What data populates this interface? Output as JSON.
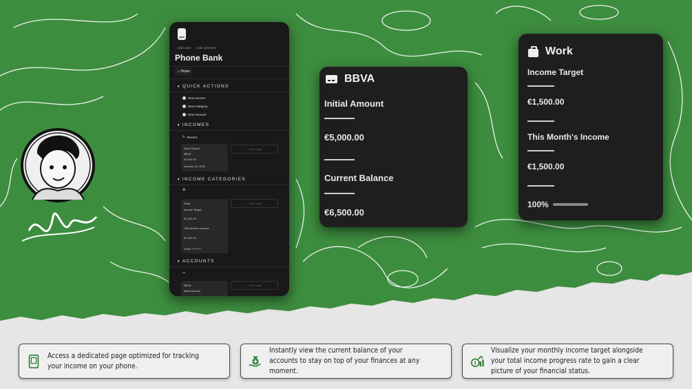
{
  "phone": {
    "meta_cover": "Add cover",
    "meta_comment": "Add comment",
    "title": "Phone Bank",
    "home": "Home",
    "sections": {
      "quick_actions": "QUICK ACTIONS",
      "incomes": "INCOMES",
      "income_categories": "INCOME CATEGORIES",
      "accounts": "ACCOUNTS"
    },
    "quick_actions": [
      "New Income",
      "New Category",
      "New Account"
    ],
    "recent": "Recent",
    "new_page": "+ New page",
    "income_card": {
      "title": "Work Payroll",
      "account": "BBVA",
      "amount": "€1,500.00",
      "date": "January 18, 2025"
    },
    "category_card": {
      "title": "Work",
      "target_label": "Income Target",
      "target": "€1,500.00",
      "month_label": "This Month's Income",
      "month": "€1,500.00",
      "percent": "100%"
    },
    "account_card": {
      "title": "BBVA",
      "label": "Initial Amount"
    }
  },
  "bbva_card": {
    "title": "BBVA",
    "initial_label": "Initial Amount",
    "initial_value": "€5,000.00",
    "balance_label": "Current Balance",
    "balance_value": "€6,500.00"
  },
  "work_card": {
    "title": "Work",
    "target_label": "Income Target",
    "target_value": "€1,500.00",
    "month_label": "This Month's Income",
    "month_value": "€1,500.00",
    "percent": "100%",
    "progress_fraction": 1.0
  },
  "features": [
    {
      "icon": "phone-icon",
      "text": "Access a dedicated page optimized for tracking your income on your phone."
    },
    {
      "icon": "money-hand-icon",
      "text": "Instantly view the current balance of your accounts to stay on top of your finances at any moment."
    },
    {
      "icon": "money-growth-icon",
      "text": "Visualize your monthly income target alongside your total income progress rate to gain a clear picture of your financial status."
    }
  ],
  "colors": {
    "green": "#3d8d3f",
    "panel": "#1e1e1e"
  }
}
